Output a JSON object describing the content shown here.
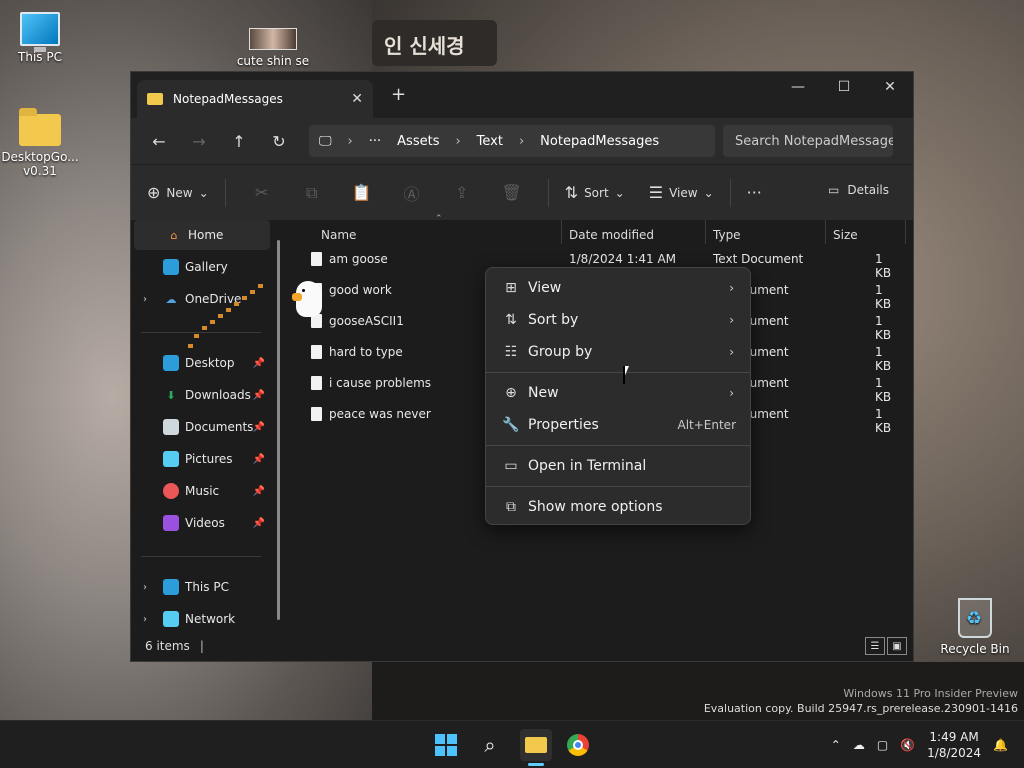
{
  "desktop": {
    "icons": [
      {
        "label": "This PC"
      },
      {
        "label": "cute shin se"
      },
      {
        "label": "DesktopGo... v0.31"
      },
      {
        "label": "Recycle Bin"
      }
    ],
    "wallpaper_banner_text": "인 신세경",
    "watermark_line1": "Windows 11 Pro Insider Preview",
    "watermark_line2": "Evaluation copy. Build 25947.rs_prerelease.230901-1416"
  },
  "window": {
    "tab_title": "NotepadMessages",
    "new_tab_symbol": "+",
    "controls": {
      "minimize": "—",
      "maximize": "☐",
      "close": "✕"
    },
    "address": {
      "overflow": "···",
      "crumbs": [
        "Assets",
        "Text",
        "NotepadMessages"
      ]
    },
    "search_placeholder": "Search NotepadMessage",
    "commandbar": {
      "new_label": "New",
      "sort_label": "Sort",
      "view_label": "View",
      "more_label": "···",
      "details_label": "Details"
    },
    "sidebar": {
      "items": [
        {
          "label": "Home"
        },
        {
          "label": "Gallery"
        },
        {
          "label": "OneDrive"
        },
        {
          "label": "Desktop"
        },
        {
          "label": "Downloads"
        },
        {
          "label": "Documents"
        },
        {
          "label": "Pictures"
        },
        {
          "label": "Music"
        },
        {
          "label": "Videos"
        },
        {
          "label": "This PC"
        },
        {
          "label": "Network"
        }
      ]
    },
    "columns": {
      "name": "Name",
      "date": "Date modified",
      "type": "Type",
      "size": "Size"
    },
    "files": [
      {
        "name": "am goose",
        "date": "1/8/2024 1:41 AM",
        "type": "Text Document",
        "size": "1 KB"
      },
      {
        "name": "good work",
        "date": "",
        "type": "cument",
        "size": "1 KB"
      },
      {
        "name": "gooseASCII1",
        "date": "",
        "type": "cument",
        "size": "1 KB"
      },
      {
        "name": "hard to type",
        "date": "",
        "type": "cument",
        "size": "1 KB"
      },
      {
        "name": "i cause problems",
        "date": "",
        "type": "cument",
        "size": "1 KB"
      },
      {
        "name": "peace was never",
        "date": "",
        "type": "cument",
        "size": "1 KB"
      }
    ],
    "status": "6 items"
  },
  "context_menu": {
    "items": [
      {
        "label": "View",
        "icon": "grid-icon"
      },
      {
        "label": "Sort by",
        "icon": "sort-icon"
      },
      {
        "label": "Group by",
        "icon": "group-icon"
      },
      {
        "label": "New",
        "icon": "plus-circle-icon"
      },
      {
        "label": "Properties",
        "icon": "wrench-icon",
        "shortcut": "Alt+Enter"
      },
      {
        "label": "Open in Terminal",
        "icon": "terminal-icon"
      },
      {
        "label": "Show more options",
        "icon": "expand-icon"
      }
    ]
  },
  "taskbar": {
    "time": "1:49 AM",
    "date": "1/8/2024"
  }
}
